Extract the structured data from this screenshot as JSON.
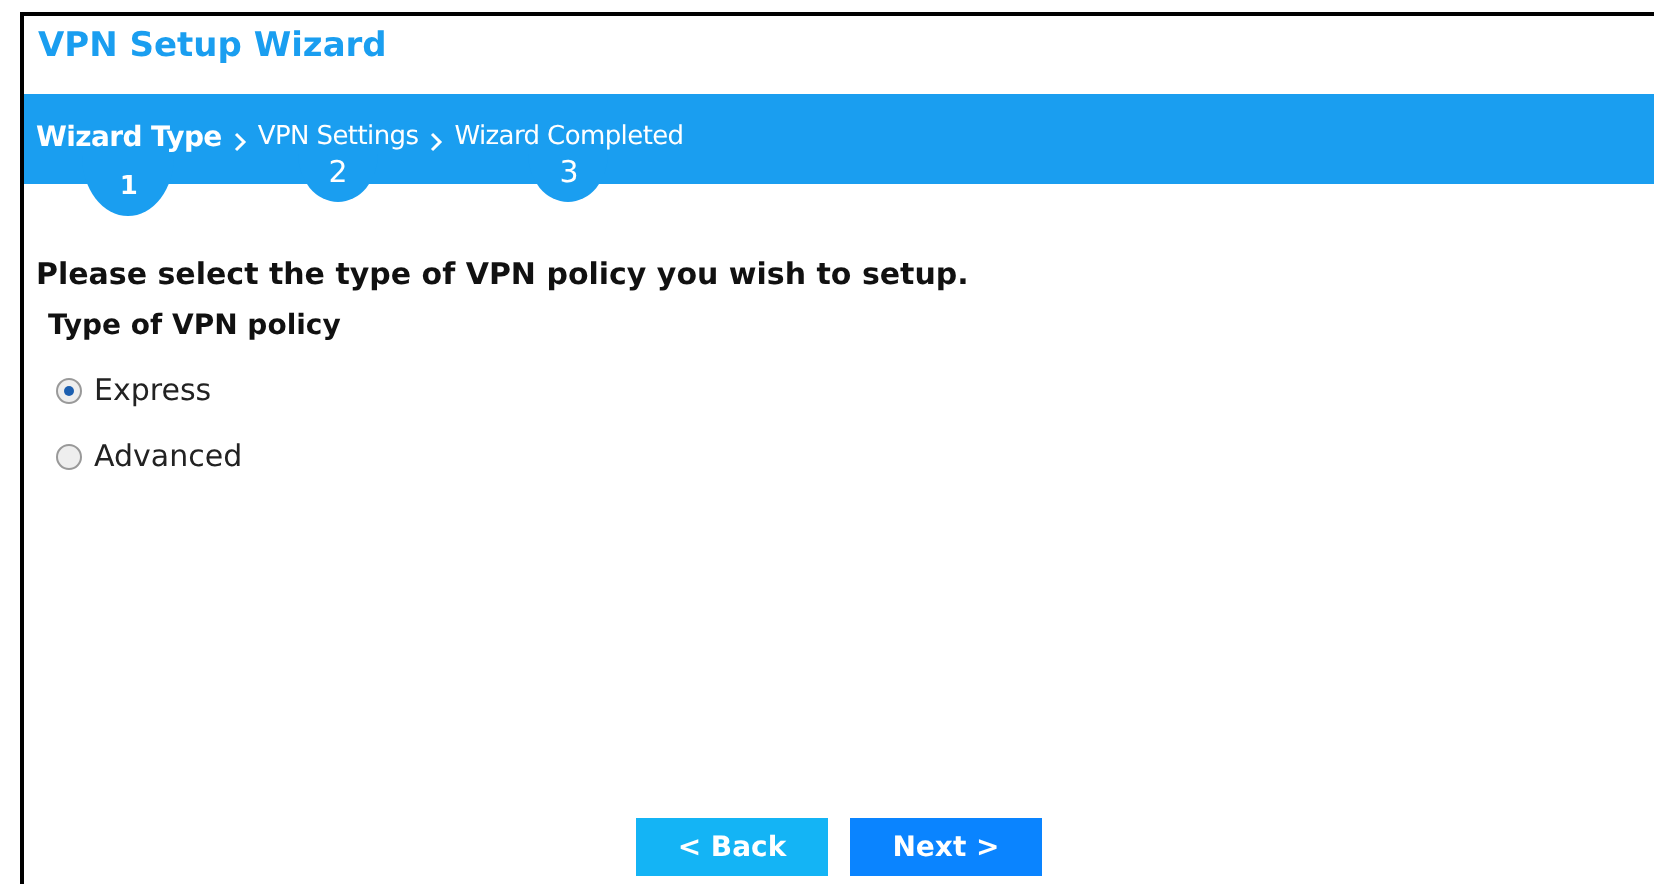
{
  "window": {
    "title": "VPN Setup Wizard"
  },
  "steps": [
    {
      "label": "Wizard Type",
      "number": "1",
      "selected": true
    },
    {
      "label": "VPN Settings",
      "number": "2",
      "selected": false
    },
    {
      "label": "Wizard Completed",
      "number": "3",
      "selected": false
    }
  ],
  "prompt": "Please select the type of VPN policy you wish to setup.",
  "group": {
    "title": "Type of VPN policy",
    "options": [
      {
        "label": "Express",
        "selected": true
      },
      {
        "label": "Advanced",
        "selected": false
      }
    ]
  },
  "buttons": [
    {
      "label": "< Back",
      "kind": "back"
    },
    {
      "label": "Next >",
      "kind": "next"
    }
  ]
}
